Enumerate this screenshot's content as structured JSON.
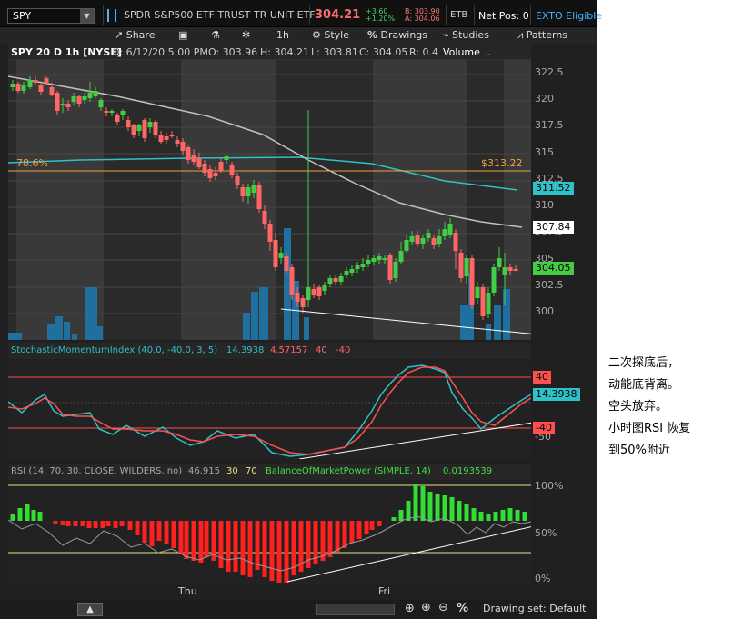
{
  "top": {
    "symbol": "SPY",
    "name": "SPDR S&P500 ETF TRUST TR UNIT ETF",
    "last": "304.21",
    "change": "+3.60",
    "change_pct": "+1.20%",
    "bid": "B: 303.90",
    "ask": "A: 304.06",
    "exchange": "ETB",
    "net_pos": "Net Pos: 0",
    "exto": "EXTO Eligible"
  },
  "toolbar": {
    "share": "Share",
    "interval": "1h",
    "style": "Style",
    "drawings": "Drawings",
    "studies": "Studies",
    "patterns": "Patterns"
  },
  "header": {
    "title": "SPY 20 D 1h [NYSE]",
    "date": "D: 6/12/20 5:00 PM",
    "open": "O: 303.96",
    "high": "H: 304.21",
    "low": "L: 303.81",
    "close": "C: 304.05",
    "range": "R: 0.4",
    "volume": "Volume",
    "more": ".."
  },
  "price": {
    "ticks": [
      "322.5",
      "320",
      "317.5",
      "315",
      "312.5",
      "310",
      "307.5",
      "305",
      "302.5",
      "300"
    ],
    "fib_label": "78.6%",
    "fib_price": "$313.22",
    "badge_cyan": "311.52",
    "badge_white": "307.84",
    "badge_green": "304.05",
    "colors": {
      "up": "#44cc44",
      "down": "#ff6666",
      "ma_fast": "#2fc0c8",
      "ma_slow": "#c0c0c0",
      "fib": "#f0a040",
      "volume": "#1f6f9f"
    }
  },
  "stoch": {
    "name": "StochasticMomentumIndex (40.0, -40.0, 3, 5)",
    "v1": "14.3938",
    "v2": "4.57157",
    "v3": "40",
    "v4": "-40",
    "ticks": [
      "50",
      "-50"
    ],
    "badge_up": "40",
    "badge_main": "14.3938",
    "badge_down": "-40"
  },
  "rsi": {
    "name": "RSI (14, 70, 30, CLOSE, WILDERS, no)",
    "v1": "46.915",
    "v2": "30",
    "v3": "70",
    "bmp": "BalanceOfMarketPower (SIMPLE, 14)",
    "bmp_val": "0.0193539",
    "ticks": [
      "100%",
      "50%",
      "0%"
    ]
  },
  "time": {
    "thu": "Thu",
    "fri": "Fri"
  },
  "bottom": {
    "drawing_set": "Drawing set: Default"
  },
  "note": {
    "l1": "二次探底后，",
    "l2": "动能底背离。",
    "l3": "空头放弃。",
    "l4": "小时图RSI 恢复",
    "l5": "到50%附近"
  }
}
